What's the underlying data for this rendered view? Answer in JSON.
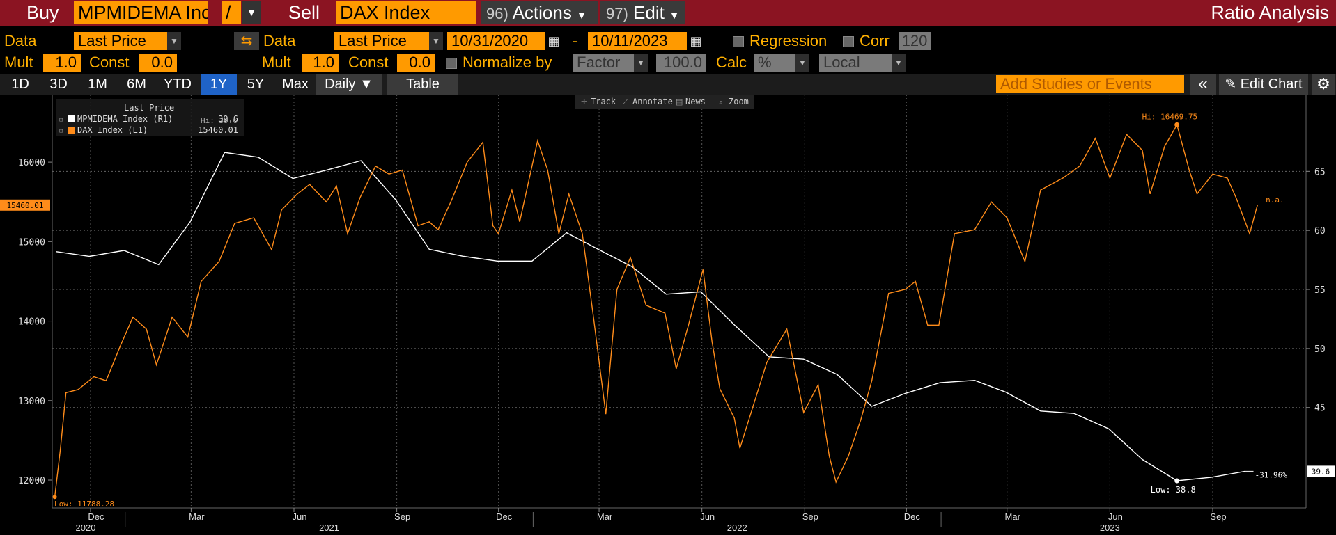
{
  "topbar": {
    "buy_label": "Buy",
    "buy_value": "MPMIDEMA Inc",
    "operator": "/",
    "sell_label": "Sell",
    "sell_value": "DAX Index",
    "actions_num": "96)",
    "actions_label": "Actions",
    "edit_num": "97)",
    "edit_label": "Edit",
    "title": "Ratio Analysis"
  },
  "settings": {
    "data_label": "Data",
    "data1_value": "Last Price",
    "data2_label": "Data",
    "data2_value": "Last Price",
    "date_start": "10/31/2020",
    "date_sep": "-",
    "date_end": "10/11/2023",
    "regression_label": "Regression",
    "corr_label": "Corr",
    "corr_value": "120",
    "mult_label": "Mult",
    "mult1_value": "1.0",
    "const_label": "Const",
    "const1_value": "0.0",
    "mult2_label": "Mult",
    "mult2_value": "1.0",
    "const2_label": "Const",
    "const2_value": "0.0",
    "normalize_label": "Normalize by",
    "normalize_value": "Factor",
    "normalize_amount": "100.0",
    "calc_label": "Calc",
    "calc_value": "%",
    "local_value": "Local"
  },
  "periods": {
    "buttons": [
      "1D",
      "3D",
      "1M",
      "6M",
      "YTD",
      "1Y",
      "5Y",
      "Max"
    ],
    "active": "1Y",
    "daily_label": "Daily ▼",
    "table_label": "Table",
    "studies_placeholder": "Add Studies or Events",
    "collapse_icon": "double-chevron-left-icon",
    "edit_chart_label": "Edit Chart",
    "gear_icon": "gear-icon"
  },
  "chart_toolbar": [
    "Track",
    "Annotate",
    "News",
    "Zoom"
  ],
  "colors": {
    "dax": "#ff8c1a",
    "pmi": "#ffffff",
    "accent": "#ff9a00",
    "topbar": "#8b1422",
    "active_period": "#1f63c7"
  },
  "chart_data": {
    "type": "line",
    "legend": {
      "header": "Last Price",
      "entries": [
        {
          "name": "MPMIDEMA Index  (R1)",
          "value": "39.6",
          "hi_label": "Hi: 39.6"
        },
        {
          "name": "DAX Index  (L1)",
          "value": "15460.01"
        }
      ]
    },
    "x_tick_labels": [
      "Dec",
      "Mar",
      "Jun",
      "Sep",
      "Dec",
      "Mar",
      "Jun",
      "Sep",
      "Dec",
      "Mar",
      "Jun",
      "Sep"
    ],
    "x_year_labels": [
      "2020",
      "2021",
      "2022",
      "2023"
    ],
    "left_axis": {
      "ticks": [
        12000,
        13000,
        14000,
        15000,
        16000
      ],
      "range": [
        11650,
        16850
      ]
    },
    "right_axis": {
      "ticks": [
        45,
        50,
        55,
        60,
        65
      ],
      "range": [
        36.5,
        71.5
      ]
    },
    "x_range": [
      "2020-10-31",
      "2023-10-11"
    ],
    "series": [
      {
        "name": "DAX Index",
        "axis": "left",
        "points": [
          [
            "2020-10-30",
            11788
          ],
          [
            "2020-11-04",
            12380
          ],
          [
            "2020-11-09",
            13100
          ],
          [
            "2020-11-20",
            13140
          ],
          [
            "2020-12-04",
            13300
          ],
          [
            "2020-12-15",
            13250
          ],
          [
            "2020-12-28",
            13700
          ],
          [
            "2021-01-08",
            14050
          ],
          [
            "2021-01-20",
            13900
          ],
          [
            "2021-01-29",
            13450
          ],
          [
            "2021-02-12",
            14050
          ],
          [
            "2021-02-26",
            13800
          ],
          [
            "2021-03-10",
            14500
          ],
          [
            "2021-03-26",
            14750
          ],
          [
            "2021-04-09",
            15230
          ],
          [
            "2021-04-26",
            15300
          ],
          [
            "2021-05-12",
            14900
          ],
          [
            "2021-05-21",
            15400
          ],
          [
            "2021-06-04",
            15600
          ],
          [
            "2021-06-15",
            15720
          ],
          [
            "2021-06-30",
            15500
          ],
          [
            "2021-07-09",
            15700
          ],
          [
            "2021-07-19",
            15100
          ],
          [
            "2021-07-30",
            15550
          ],
          [
            "2021-08-13",
            15950
          ],
          [
            "2021-08-25",
            15850
          ],
          [
            "2021-09-06",
            15900
          ],
          [
            "2021-09-20",
            15200
          ],
          [
            "2021-09-30",
            15250
          ],
          [
            "2021-10-08",
            15150
          ],
          [
            "2021-10-20",
            15520
          ],
          [
            "2021-11-03",
            16000
          ],
          [
            "2021-11-17",
            16250
          ],
          [
            "2021-11-26",
            15200
          ],
          [
            "2021-12-01",
            15100
          ],
          [
            "2021-12-13",
            15650
          ],
          [
            "2021-12-20",
            15250
          ],
          [
            "2022-01-05",
            16270
          ],
          [
            "2022-01-14",
            15900
          ],
          [
            "2022-01-24",
            15100
          ],
          [
            "2022-02-02",
            15600
          ],
          [
            "2022-02-14",
            15100
          ],
          [
            "2022-02-24",
            14050
          ],
          [
            "2022-03-07",
            12830
          ],
          [
            "2022-03-17",
            14400
          ],
          [
            "2022-03-29",
            14800
          ],
          [
            "2022-04-12",
            14200
          ],
          [
            "2022-04-29",
            14100
          ],
          [
            "2022-05-09",
            13400
          ],
          [
            "2022-05-20",
            13950
          ],
          [
            "2022-06-02",
            14650
          ],
          [
            "2022-06-10",
            13750
          ],
          [
            "2022-06-17",
            13150
          ],
          [
            "2022-06-30",
            12780
          ],
          [
            "2022-07-05",
            12400
          ],
          [
            "2022-07-15",
            12850
          ],
          [
            "2022-07-29",
            13480
          ],
          [
            "2022-08-16",
            13900
          ],
          [
            "2022-08-31",
            12850
          ],
          [
            "2022-09-13",
            13200
          ],
          [
            "2022-09-23",
            12300
          ],
          [
            "2022-09-29",
            11975
          ],
          [
            "2022-10-10",
            12300
          ],
          [
            "2022-10-21",
            12750
          ],
          [
            "2022-10-31",
            13250
          ],
          [
            "2022-11-15",
            14350
          ],
          [
            "2022-11-30",
            14400
          ],
          [
            "2022-12-09",
            14500
          ],
          [
            "2022-12-20",
            13950
          ],
          [
            "2022-12-30",
            13950
          ],
          [
            "2023-01-13",
            15100
          ],
          [
            "2023-01-31",
            15150
          ],
          [
            "2023-02-15",
            15500
          ],
          [
            "2023-03-01",
            15300
          ],
          [
            "2023-03-17",
            14750
          ],
          [
            "2023-03-31",
            15650
          ],
          [
            "2023-04-20",
            15800
          ],
          [
            "2023-05-05",
            15950
          ],
          [
            "2023-05-19",
            16300
          ],
          [
            "2023-06-01",
            15800
          ],
          [
            "2023-06-16",
            16350
          ],
          [
            "2023-06-30",
            16150
          ],
          [
            "2023-07-07",
            15600
          ],
          [
            "2023-07-20",
            16200
          ],
          [
            "2023-07-31",
            16470
          ],
          [
            "2023-08-11",
            15900
          ],
          [
            "2023-08-18",
            15600
          ],
          [
            "2023-09-01",
            15850
          ],
          [
            "2023-09-14",
            15800
          ],
          [
            "2023-09-22",
            15550
          ],
          [
            "2023-10-04",
            15100
          ],
          [
            "2023-10-11",
            15460
          ]
        ]
      },
      {
        "name": "MPMIDEMA Index",
        "axis": "right",
        "points": [
          [
            "2020-10-31",
            58.2
          ],
          [
            "2020-11-30",
            57.8
          ],
          [
            "2020-12-31",
            58.3
          ],
          [
            "2021-01-31",
            57.1
          ],
          [
            "2021-02-28",
            60.7
          ],
          [
            "2021-03-31",
            66.6
          ],
          [
            "2021-04-30",
            66.2
          ],
          [
            "2021-05-31",
            64.4
          ],
          [
            "2021-06-30",
            65.1
          ],
          [
            "2021-07-31",
            65.9
          ],
          [
            "2021-08-31",
            62.6
          ],
          [
            "2021-09-30",
            58.4
          ],
          [
            "2021-10-31",
            57.8
          ],
          [
            "2021-11-30",
            57.4
          ],
          [
            "2021-12-31",
            57.4
          ],
          [
            "2022-01-31",
            59.8
          ],
          [
            "2022-02-28",
            58.4
          ],
          [
            "2022-03-31",
            56.9
          ],
          [
            "2022-04-30",
            54.6
          ],
          [
            "2022-05-31",
            54.8
          ],
          [
            "2022-06-30",
            52.0
          ],
          [
            "2022-07-31",
            49.3
          ],
          [
            "2022-08-31",
            49.1
          ],
          [
            "2022-09-30",
            47.8
          ],
          [
            "2022-10-31",
            45.1
          ],
          [
            "2022-11-30",
            46.2
          ],
          [
            "2022-12-31",
            47.1
          ],
          [
            "2023-01-31",
            47.3
          ],
          [
            "2023-02-28",
            46.3
          ],
          [
            "2023-03-31",
            44.7
          ],
          [
            "2023-04-30",
            44.5
          ],
          [
            "2023-05-31",
            43.2
          ],
          [
            "2023-06-30",
            40.6
          ],
          [
            "2023-07-31",
            38.8
          ],
          [
            "2023-08-31",
            39.1
          ],
          [
            "2023-09-30",
            39.6
          ]
        ]
      }
    ],
    "annotations": {
      "dax_high": "Hi: 16469.75",
      "dax_low": "Low: 11788.28",
      "pmi_low": "Low: 38.8",
      "pmi_change": "-31.96%",
      "dax_last_tag": "15460.01",
      "pmi_last_tag": "39.6",
      "na_label": "n.a."
    },
    "grid": true,
    "legend_position": "top-left"
  }
}
